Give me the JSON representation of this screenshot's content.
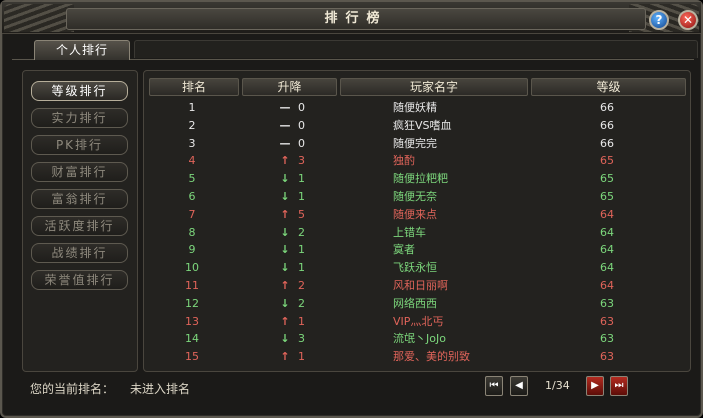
{
  "window": {
    "title": "排行榜"
  },
  "titlebar": {
    "help_icon": "question-icon",
    "close_icon": "close-icon",
    "help_glyph": "?",
    "close_glyph": "✕"
  },
  "tabs": [
    {
      "label": "个人排行"
    }
  ],
  "sidebar": {
    "items": [
      {
        "label": "等级排行",
        "active": true
      },
      {
        "label": "实力排行",
        "active": false
      },
      {
        "label": "PK排行",
        "active": false
      },
      {
        "label": "财富排行",
        "active": false
      },
      {
        "label": "富翁排行",
        "active": false
      },
      {
        "label": "活跃度排行",
        "active": false
      },
      {
        "label": "战绩排行",
        "active": false
      },
      {
        "label": "荣誉值排行",
        "active": false
      }
    ]
  },
  "table": {
    "headers": [
      "排名",
      "升降",
      "玩家名字",
      "等级"
    ],
    "rows": [
      {
        "rank": "1",
        "arrow": "—",
        "change": "0",
        "name": "随便妖精",
        "level": "66",
        "color": "#e8e8e8",
        "arrow_color": "#e8e8e8"
      },
      {
        "rank": "2",
        "arrow": "—",
        "change": "0",
        "name": "疯狂VS嗜血",
        "level": "66",
        "color": "#e8e8e8",
        "arrow_color": "#e8e8e8"
      },
      {
        "rank": "3",
        "arrow": "—",
        "change": "0",
        "name": "随便完完",
        "level": "66",
        "color": "#e8e8e8",
        "arrow_color": "#e8e8e8"
      },
      {
        "rank": "4",
        "arrow": "↑",
        "change": "3",
        "name": "独酌",
        "level": "65",
        "color": "#e0645a",
        "arrow_color": "#e0645a"
      },
      {
        "rank": "5",
        "arrow": "↓",
        "change": "1",
        "name": "随便拉粑粑",
        "level": "65",
        "color": "#7cd77c",
        "arrow_color": "#7cd77c"
      },
      {
        "rank": "6",
        "arrow": "↓",
        "change": "1",
        "name": "随便无奈",
        "level": "65",
        "color": "#7cd77c",
        "arrow_color": "#7cd77c"
      },
      {
        "rank": "7",
        "arrow": "↑",
        "change": "5",
        "name": "随便来点",
        "level": "64",
        "color": "#e0645a",
        "arrow_color": "#e0645a"
      },
      {
        "rank": "8",
        "arrow": "↓",
        "change": "2",
        "name": "上错车",
        "level": "64",
        "color": "#7cd77c",
        "arrow_color": "#7cd77c"
      },
      {
        "rank": "9",
        "arrow": "↓",
        "change": "1",
        "name": "寞者",
        "level": "64",
        "color": "#7cd77c",
        "arrow_color": "#7cd77c"
      },
      {
        "rank": "10",
        "arrow": "↓",
        "change": "1",
        "name": "飞跃永恒",
        "level": "64",
        "color": "#7cd77c",
        "arrow_color": "#7cd77c"
      },
      {
        "rank": "11",
        "arrow": "↑",
        "change": "2",
        "name": "风和日丽啊",
        "level": "64",
        "color": "#e0645a",
        "arrow_color": "#e0645a"
      },
      {
        "rank": "12",
        "arrow": "↓",
        "change": "2",
        "name": "网络西西",
        "level": "63",
        "color": "#7cd77c",
        "arrow_color": "#7cd77c"
      },
      {
        "rank": "13",
        "arrow": "↑",
        "change": "1",
        "name": "VIP灬北丐",
        "level": "63",
        "color": "#e0645a",
        "arrow_color": "#e0645a"
      },
      {
        "rank": "14",
        "arrow": "↓",
        "change": "3",
        "name": "流氓丶JoJo",
        "level": "63",
        "color": "#7cd77c",
        "arrow_color": "#7cd77c"
      },
      {
        "rank": "15",
        "arrow": "↑",
        "change": "1",
        "name": "那爱、美的别致",
        "level": "63",
        "color": "#e0645a",
        "arrow_color": "#e0645a"
      }
    ]
  },
  "footer": {
    "current_rank_label": "您的当前排名：",
    "current_rank_value": "未进入排名",
    "page_indicator": "1/34",
    "first_glyph": "⏮",
    "prev_glyph": "◀",
    "next_glyph": "▶",
    "last_glyph": "⏭"
  }
}
